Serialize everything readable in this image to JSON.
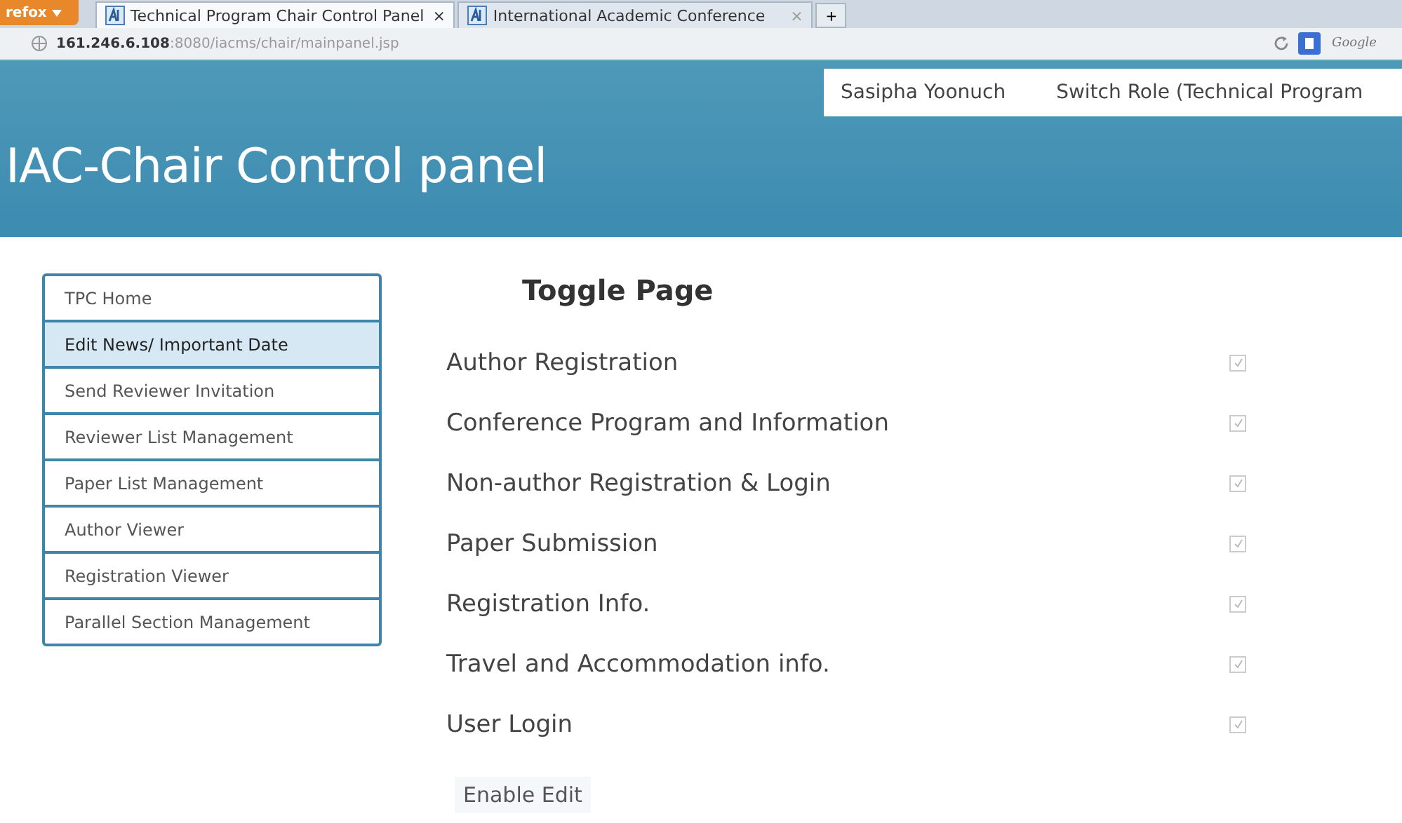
{
  "browser": {
    "menu_button": "refox",
    "tabs": [
      {
        "title": "Technical Program Chair Control Panel",
        "selected": true,
        "close": "×"
      },
      {
        "title": "International Academic Conference",
        "selected": false,
        "close": "×"
      }
    ],
    "new_tab": "+",
    "address": "**161.246.6.108**:8080/iacms/chair/mainpanel.jsp",
    "search": {
      "placeholder": "Google"
    }
  },
  "header": {
    "title": "IAC-Chair Control panel",
    "user": "Sasipha Yoonuch",
    "switch_role": "Switch Role (Technical Program"
  },
  "sidebar": {
    "items": [
      {
        "label": "TPC Home",
        "selected": false
      },
      {
        "label": "Edit News/ Important Date",
        "selected": true
      },
      {
        "label": "Send Reviewer Invitation",
        "selected": false
      },
      {
        "label": "Reviewer List Management",
        "selected": false
      },
      {
        "label": "Paper List Management",
        "selected": false
      },
      {
        "label": "Author Viewer",
        "selected": false
      },
      {
        "label": "Registration Viewer",
        "selected": false
      },
      {
        "label": "Parallel Section Management",
        "selected": false
      }
    ]
  },
  "toggle": {
    "title": "Toggle Page",
    "pages": [
      {
        "label": "Author Registration",
        "checked": true
      },
      {
        "label": "Conference Program and Information",
        "checked": true
      },
      {
        "label": "Non-author Registration & Login",
        "checked": true
      },
      {
        "label": "Paper Submission",
        "checked": true
      },
      {
        "label": "Registration Info.",
        "checked": true
      },
      {
        "label": "Travel and Accommodation info.",
        "checked": true
      },
      {
        "label": "User Login",
        "checked": true
      }
    ],
    "button": "Enable Edit"
  }
}
